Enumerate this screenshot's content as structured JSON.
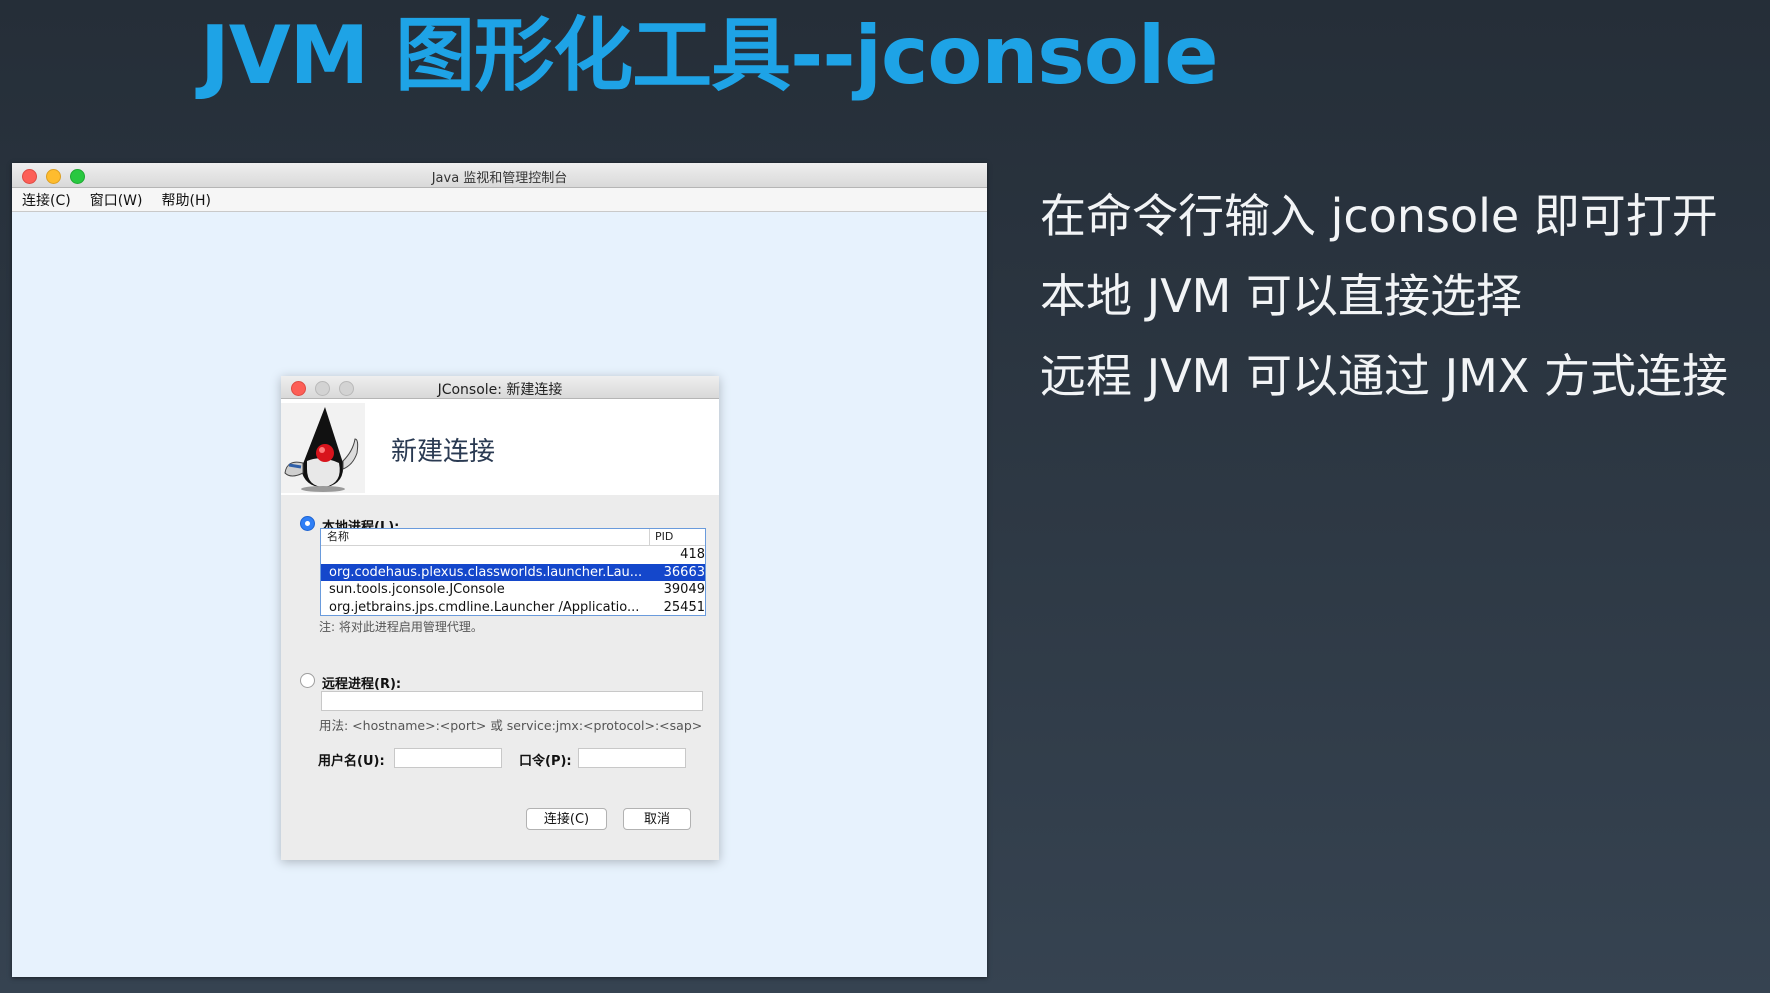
{
  "slide": {
    "title": "JVM 图形化工具--jconsole",
    "bullets": [
      "在命令行输入 jconsole 即可打开",
      "本地 JVM 可以直接选择",
      "远程 JVM 可以通过 JMX 方式连接"
    ]
  },
  "main_window": {
    "title": "Java 监视和管理控制台",
    "menu": [
      "连接(C)",
      "窗口(W)",
      "帮助(H)"
    ]
  },
  "dialog": {
    "title": "JConsole: 新建连接",
    "heading": "新建连接",
    "local_process_label": "本地进程(L):",
    "table": {
      "columns": [
        "名称",
        "PID"
      ],
      "rows": [
        {
          "name": "",
          "pid": "418"
        },
        {
          "name": "org.codehaus.plexus.classworlds.launcher.Lau...",
          "pid": "36663"
        },
        {
          "name": "sun.tools.jconsole.JConsole",
          "pid": "39049"
        },
        {
          "name": "org.jetbrains.jps.cmdline.Launcher /Applicatio...",
          "pid": "25451"
        }
      ],
      "selected_index": 1
    },
    "note": "注: 将对此进程启用管理代理。",
    "remote_process_label": "远程进程(R):",
    "remote_value": "",
    "usage": "用法: <hostname>:<port> 或 service:jmx:<protocol>:<sap>",
    "username_label": "用户名(U):",
    "username_value": "",
    "password_label": "口令(P):",
    "password_value": "",
    "connect_button": "连接(C)",
    "cancel_button": "取消"
  },
  "colors": {
    "title_blue": "#1ea3e6",
    "selection_blue": "#1447cb",
    "window_background": "#e7f2fd"
  }
}
